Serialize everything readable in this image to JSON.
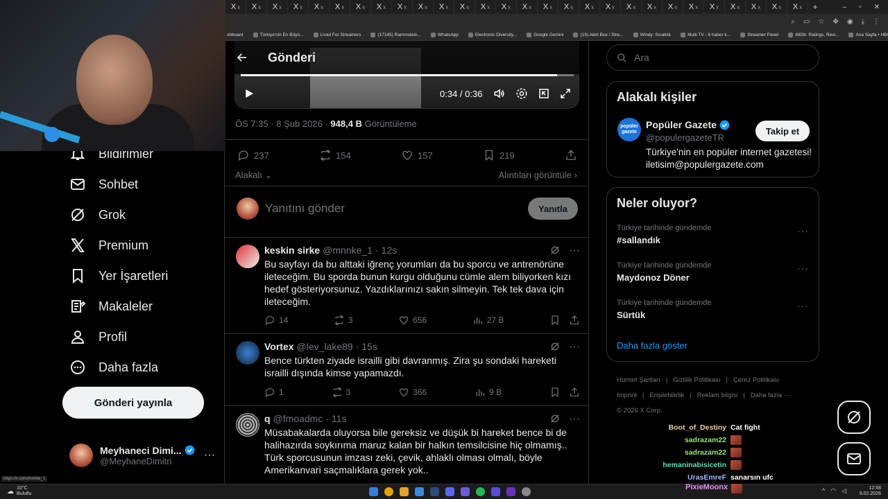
{
  "browser": {
    "tab_favicon": "X",
    "tab_close": "x",
    "tab_count": 28,
    "window_controls": [
      "–",
      "▫",
      "✕"
    ],
    "bookmarks": [
      "shboard",
      "Türkiye'nin En Büyü...",
      "Livad For Streamers",
      "(17145) Rammstein...",
      "WhatsApp",
      "Electronic Diversity...",
      "Google Gemini",
      "(19) Alert Box / Stre...",
      "Windy: Sıcaklık",
      "Multi TV - 6 haber k...",
      "Streamer Panel",
      "IMDb: Ratings, Revi...",
      "Ana Sayfa • HBO Max",
      "Tüm Yer İşaretleri"
    ],
    "status_url": "https://x.com/mnnke_1"
  },
  "nav": {
    "items": [
      {
        "label": "Bildirimler",
        "icon": "bell-icon"
      },
      {
        "label": "Sohbet",
        "icon": "mail-icon"
      },
      {
        "label": "Grok",
        "icon": "grok-icon"
      },
      {
        "label": "Premium",
        "icon": "x-logo-icon"
      },
      {
        "label": "Yer İşaretleri",
        "icon": "bookmark-icon"
      },
      {
        "label": "Makaleler",
        "icon": "article-icon"
      },
      {
        "label": "Profil",
        "icon": "person-icon"
      },
      {
        "label": "Daha fazla",
        "icon": "more-circle-icon"
      }
    ],
    "post_button": "Gönderi yayınla",
    "profile": {
      "name": "Meyhaneci Dimi...",
      "handle": "@MeyhaneDimitri",
      "more": "···"
    }
  },
  "main": {
    "title": "Gönderi",
    "video": {
      "time": "0:34 / 0:36",
      "progress": 0.95
    },
    "meta": {
      "time": "ÖS 7:35",
      "sep": "·",
      "date": "8 Şub 2026",
      "views": "948,4 B",
      "views_label": "Görüntüleme"
    },
    "stats": {
      "replies": "237",
      "reposts": "154",
      "likes": "157",
      "bookmarks": "219"
    },
    "sort_label": "Alakalı",
    "quotes_link": "Alıntıları görüntüle",
    "reply_placeholder": "Yanıtını gönder",
    "reply_button": "Yanıtla",
    "replies": [
      {
        "name": "keskin sirke",
        "handle": "@mnnke_1",
        "time": "12s",
        "text": "Bu sayfayı da bu alttaki iğrenç yorumları da bu sporcu ve antrenörüne ileteceğim. Bu sporda bunun kurgu olduğunu cümle alem biliyorken kızı hedef gösteriyorsunuz. Yazdıklarınızı sakın silmeyin. Tek tek dava için ileteceğim.",
        "replies": "14",
        "reposts": "3",
        "likes": "656",
        "views": "27 B"
      },
      {
        "name": "Vortex",
        "handle": "@lev_lake89",
        "time": "15s",
        "text": "Bence türkten ziyade israilli gibi davranmış. Zira şu sondaki hareketi israilli dışında kimse yapamazdı.",
        "replies": "1",
        "reposts": "3",
        "likes": "366",
        "views": "9 B"
      },
      {
        "name": "q",
        "handle": "@fmoadmc",
        "time": "11s",
        "text": "Müsabakalarda oluyorsa bile gereksiz ve düşük bi hareket bence bi de halihazırda soykırıma maruz kalan bir halkın temsilcisine hiç olmamış.. Türk sporcusunun imzası zeki, çevik, ahlaklı olması olmalı, böyle Amerikanvari saçmalıklara gerek yok..",
        "replies": "",
        "reposts": "",
        "likes": "",
        "views": ""
      }
    ]
  },
  "sidebar": {
    "search_placeholder": "Ara",
    "related": {
      "title": "Alakalı kişiler",
      "name": "Popüler Gazete",
      "handle": "@populergazeteTR",
      "bio": "Türkiye'nin en popüler internet gazetesi! iletisim@populergazete.com",
      "follow": "Takip et",
      "avatar_text": "popüler gazete"
    },
    "trends": {
      "title": "Neler oluyor?",
      "items": [
        {
          "context": "Türkiye tarihinde gündemde",
          "name": "#sallandık"
        },
        {
          "context": "Türkiye tarihinde gündemde",
          "name": "Maydonoz Döner"
        },
        {
          "context": "Türkiye tarihinde gündemde",
          "name": "Sürtük"
        }
      ],
      "show_more": "Daha fazla göster"
    },
    "footer": [
      "Hizmet Şartları",
      "Gizlilik Politikası",
      "Çerez Politikası",
      "Imprint",
      "Erişilebilirlik",
      "Reklam bilgisi",
      "Daha fazla ···",
      "© 2026 X Corp."
    ]
  },
  "chat": [
    {
      "user": "Boot_of_Destiny",
      "color": "#f0d0a0",
      "msg": "Cat fight"
    },
    {
      "user": "sadrazam22",
      "color": "#9be37a",
      "msg": ""
    },
    {
      "user": "sadrazam22",
      "color": "#9be37a",
      "msg": ""
    },
    {
      "user": "hemaninabisicetin",
      "color": "#5fe0b0",
      "msg": ""
    },
    {
      "user": "UrasEmreF",
      "color": "#a6b7ff",
      "msg": "sanarsın ufc"
    },
    {
      "user": "PixieMoonx",
      "color": "#e38cf7",
      "msg": ""
    }
  ],
  "taskbar": {
    "weather": "10°C",
    "weather_desc": "Bulutlu",
    "time": "12:58",
    "date": "9.02.2026"
  }
}
